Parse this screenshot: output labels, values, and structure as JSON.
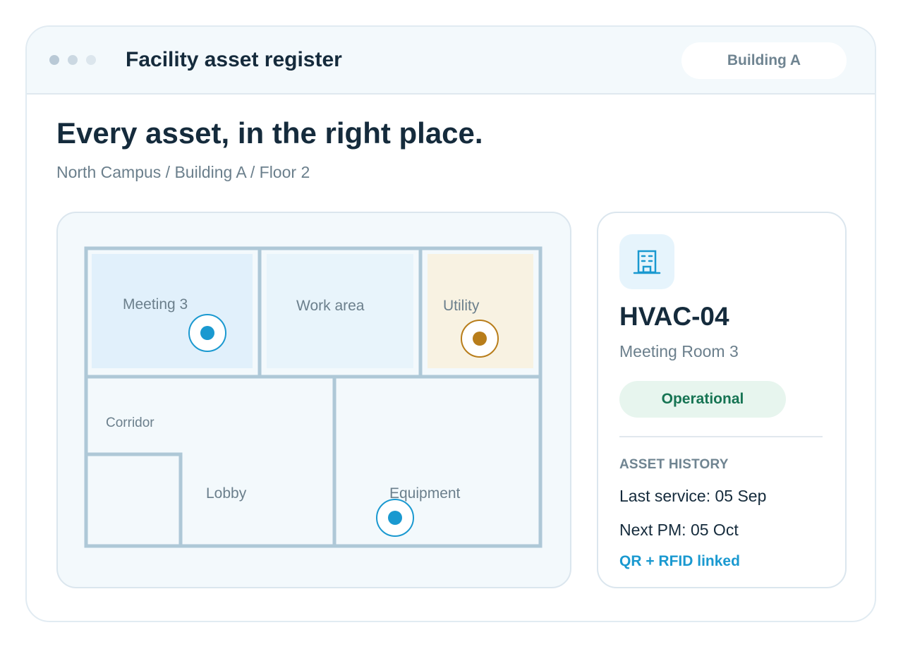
{
  "window": {
    "title": "Facility asset register",
    "building_selector": "Building A"
  },
  "header": {
    "headline": "Every asset, in the right place.",
    "breadcrumb": "North Campus / Building A / Floor 2"
  },
  "floor_plan": {
    "rooms": {
      "meeting3": "Meeting 3",
      "work_area": "Work area",
      "utility": "Utility",
      "corridor": "Corridor",
      "lobby": "Lobby",
      "equipment": "Equipment"
    },
    "markers": [
      {
        "name": "asset-marker-meeting3",
        "status": "selected",
        "color": "#1a99d0"
      },
      {
        "name": "asset-marker-utility",
        "status": "warning",
        "color": "#b87d1a"
      },
      {
        "name": "asset-marker-equipment",
        "status": "normal",
        "color": "#1a99d0"
      }
    ]
  },
  "asset": {
    "icon": "building-icon",
    "name": "HVAC-04",
    "location": "Meeting Room 3",
    "status": "Operational",
    "history_heading": "ASSET HISTORY",
    "last_service": "Last service: 05 Sep",
    "next_pm": "Next PM: 05 Oct",
    "link_status": "QR + RFID linked"
  },
  "colors": {
    "accent": "#1a99d0",
    "warning": "#b87d1a",
    "success_text": "#167453",
    "success_bg": "#e7f5ee",
    "wall": "#aec8d7"
  }
}
